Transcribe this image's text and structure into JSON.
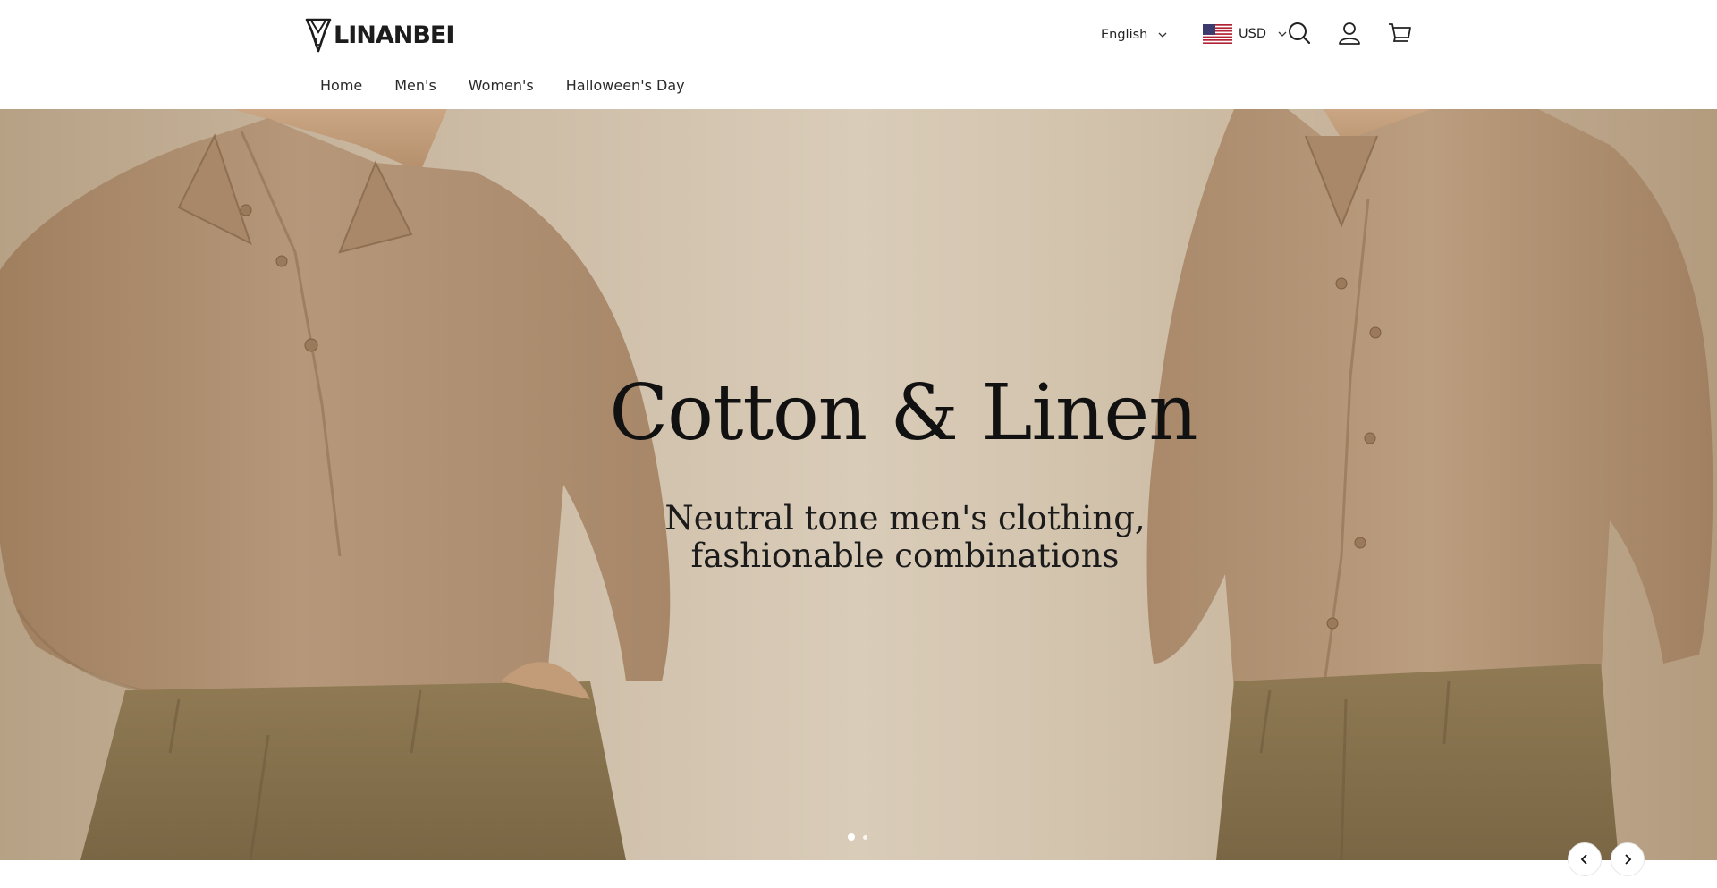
{
  "brand": {
    "name": "LINANBEI"
  },
  "header": {
    "language": {
      "selected": "English"
    },
    "currency": {
      "selected": "USD",
      "flag_icon": "us-flag-icon"
    },
    "icons": [
      "search-icon",
      "account-icon",
      "cart-icon"
    ]
  },
  "nav": {
    "items": [
      {
        "label": "Home"
      },
      {
        "label": "Men's"
      },
      {
        "label": "Women's"
      },
      {
        "label": "Halloween's Day"
      }
    ]
  },
  "hero": {
    "title": "Cotton & Linen",
    "subtitle_line1": "Neutral tone men's clothing,",
    "subtitle_line2": "fashionable combinations",
    "slides_total": 2,
    "active_slide": 1
  },
  "colors": {
    "text": "#1f1f1f",
    "hero_bg": "#d2c3ae",
    "shirt": "#b08f6e",
    "pants": "#8c7750"
  }
}
